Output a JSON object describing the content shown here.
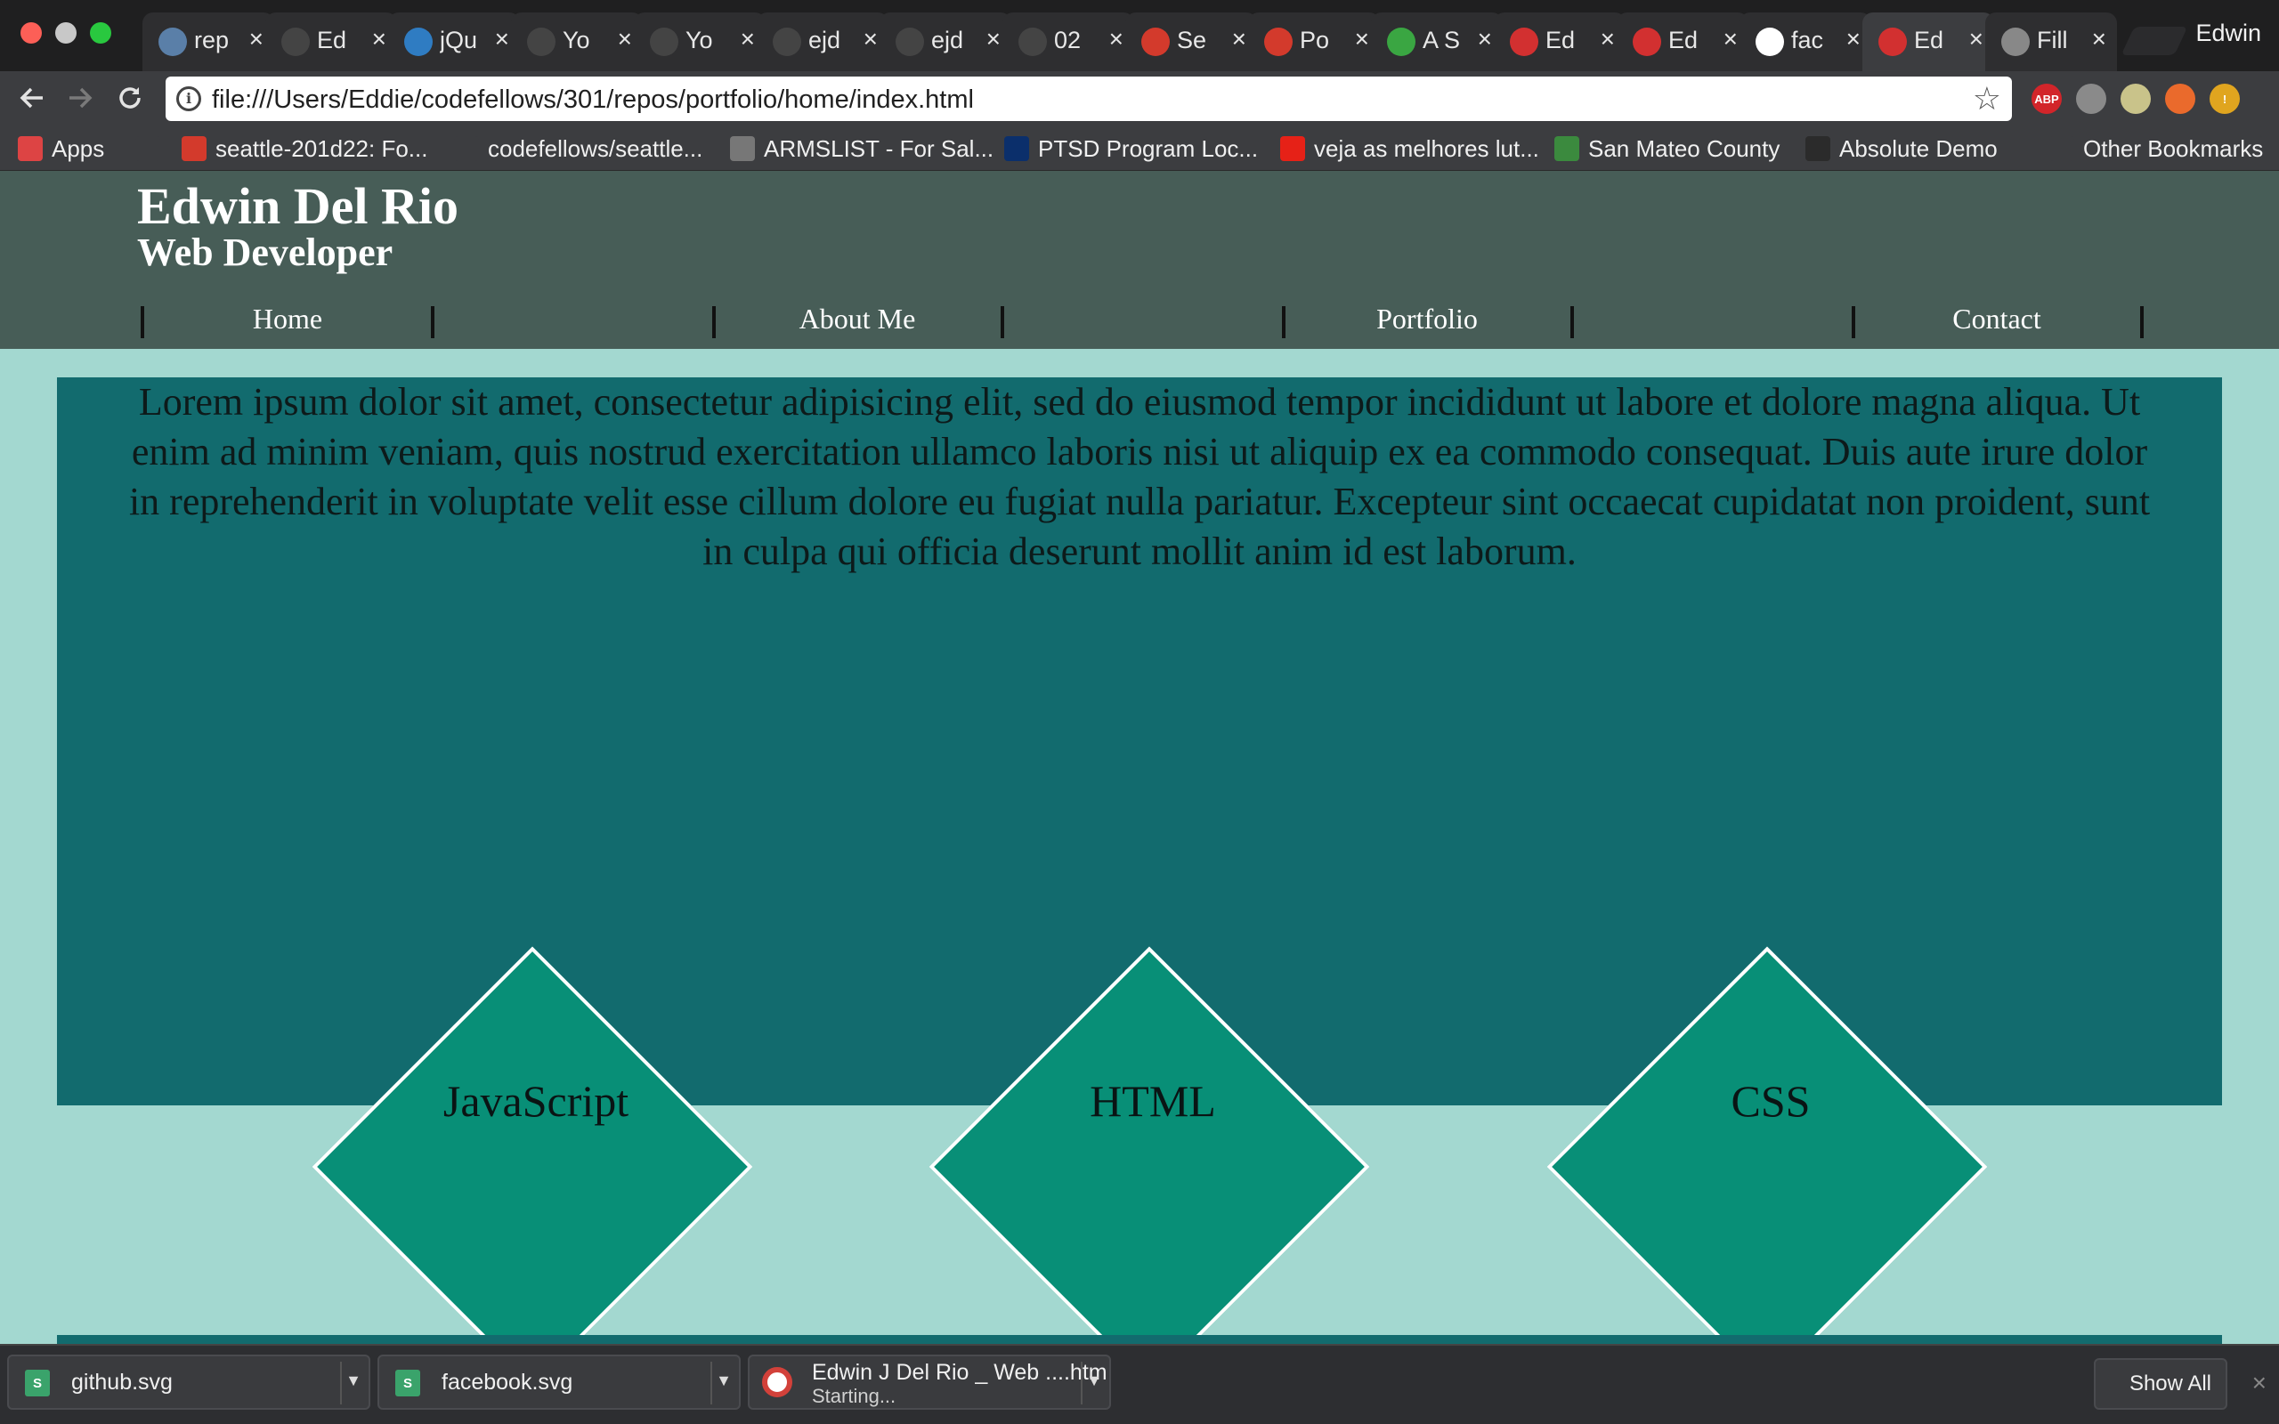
{
  "browser": {
    "profile_name": "Edwin",
    "tabs": [
      {
        "label": "rep",
        "icon": "swirl-icon",
        "color": "#5a7fa8"
      },
      {
        "label": "Ed",
        "icon": "github-icon",
        "color": "#444444"
      },
      {
        "label": "jQu",
        "icon": "jquery-icon",
        "color": "#2f7cc2"
      },
      {
        "label": "Yo",
        "icon": "github-icon",
        "color": "#444444"
      },
      {
        "label": "Yo",
        "icon": "github-icon",
        "color": "#444444"
      },
      {
        "label": "ejd",
        "icon": "github-icon",
        "color": "#444444"
      },
      {
        "label": "ejd",
        "icon": "github-icon",
        "color": "#444444"
      },
      {
        "label": "02",
        "icon": "github-icon",
        "color": "#444444"
      },
      {
        "label": "Se",
        "icon": "codefellows-icon",
        "color": "#d33a2c"
      },
      {
        "label": "Po",
        "icon": "codefellows-icon",
        "color": "#d33a2c"
      },
      {
        "label": "A S",
        "icon": "s-logo-icon",
        "color": "#3aa642"
      },
      {
        "label": "Ed",
        "icon": "code-shield-icon",
        "color": "#d23030"
      },
      {
        "label": "Ed",
        "icon": "code-shield-icon",
        "color": "#d23030"
      },
      {
        "label": "fac",
        "icon": "google-icon",
        "color": "#ffffff"
      },
      {
        "label": "Ed",
        "icon": "code-shield-icon",
        "color": "#d23030",
        "active": true
      },
      {
        "label": "Fill",
        "icon": "file-icon",
        "color": "#888888"
      }
    ],
    "close_glyph": "×",
    "url": "file:///Users/Eddie/codefellows/301/repos/portfolio/home/index.html",
    "extensions": [
      {
        "name": "adblock-plus-icon",
        "text": "ABP",
        "color": "#d2252a"
      },
      {
        "name": "puzzle-extension-icon",
        "text": "",
        "color": "#8a8a8a"
      },
      {
        "name": "lightbulb-extension-icon",
        "text": "",
        "color": "#c9c38a"
      },
      {
        "name": "pencil-extension-icon",
        "text": "",
        "color": "#ea6a2c"
      },
      {
        "name": "alert-extension-icon",
        "text": "!",
        "color": "#e0a51f"
      }
    ]
  },
  "bookmarks": [
    {
      "label": "Apps",
      "icon": "apps-grid-icon",
      "color": "#d44"
    },
    {
      "label": "",
      "icon": "file-icon",
      "color": "#3c3d40"
    },
    {
      "label": "seattle-201d22: Fo...",
      "icon": "codefellows-icon",
      "color": "#d33a2c"
    },
    {
      "label": "codefellows/seattle...",
      "icon": "github-icon",
      "color": "#3c3d40"
    },
    {
      "label": "ARMSLIST - For Sal...",
      "icon": "armslist-icon",
      "color": "#777777"
    },
    {
      "label": "PTSD Program Loc...",
      "icon": "va-icon",
      "color": "#0b2f6b"
    },
    {
      "label": "veja as melhores lut...",
      "icon": "youtube-icon",
      "color": "#e62117"
    },
    {
      "label": "San Mateo County",
      "icon": "house-icon",
      "color": "#3b8a3e"
    },
    {
      "label": "Absolute Demo",
      "icon": "globe-icon",
      "color": "#2b2b2b"
    },
    {
      "label": "Other Bookmarks",
      "icon": "folder-icon",
      "color": "#3c3d40"
    }
  ],
  "site": {
    "title": "Edwin Del Rio",
    "subtitle": "Web Developer",
    "nav": [
      "Home",
      "About Me",
      "Portfolio",
      "Contact"
    ],
    "intro": "Lorem ipsum dolor sit amet, consectetur adipisicing elit, sed do eiusmod tempor incididunt ut labore et dolore magna aliqua. Ut enim ad minim veniam, quis nostrud exercitation ullamco laboris nisi ut aliquip ex ea commodo consequat. Duis aute irure dolor in reprehenderit in voluptate velit esse cillum dolore eu fugiat nulla pariatur. Excepteur sint occaecat cupidatat non proident, sunt in culpa qui officia deserunt mollit anim id est laborum.",
    "skills": [
      "JavaScript",
      "HTML",
      "CSS"
    ],
    "colors": {
      "header": "#475d57",
      "hero": "#126b6e",
      "page": "#a3d8d0",
      "diamond": "#088f77"
    }
  },
  "downloads": {
    "items": [
      {
        "name": "github.svg",
        "status": ""
      },
      {
        "name": "facebook.svg",
        "status": ""
      },
      {
        "name": "Edwin J Del Rio _ Web ....htm",
        "status": "Starting..."
      }
    ],
    "show_all": "Show All"
  }
}
